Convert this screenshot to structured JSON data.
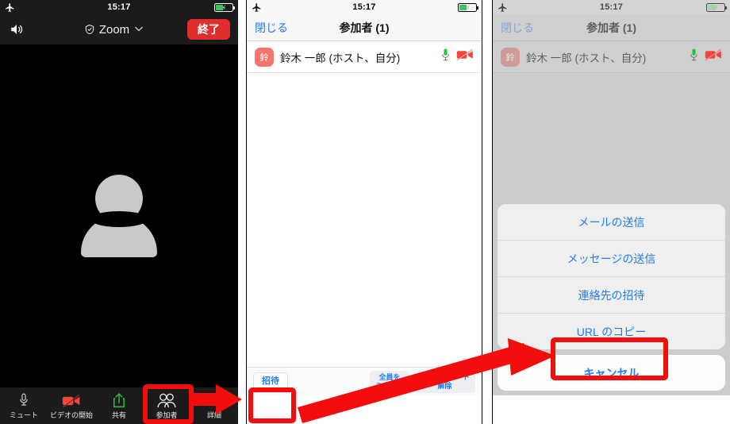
{
  "panels": {
    "meeting": {
      "status_bar": {
        "icon": "airplane-mode-icon",
        "time": "15:17",
        "battery": "battery-charging-icon"
      },
      "top_bar": {
        "speaker_icon": "speaker-icon",
        "shield_icon": "shield-check-icon",
        "app_name": "Zoom",
        "chevron": "⌄",
        "end_label": "終了"
      },
      "video": {
        "placeholder_icon": "person-silhouette-icon"
      },
      "toolbar": [
        {
          "icon": "microphone-icon",
          "label": "ミュート"
        },
        {
          "icon": "video-off-icon",
          "label": "ビデオの開始"
        },
        {
          "icon": "share-icon",
          "label": "共有"
        },
        {
          "icon": "participants-icon",
          "label": "参加者"
        },
        {
          "icon": "more-icon",
          "label": "詳細"
        }
      ]
    },
    "participants": {
      "status_bar": {
        "icon": "airplane-mode-icon",
        "time": "15:17",
        "battery": "battery-charging-icon"
      },
      "nav": {
        "close_label": "閉じる",
        "title": "参加者 (1)"
      },
      "rows": [
        {
          "avatar_initial": "鈴",
          "name": "鈴木 一郎 (ホスト、自分)",
          "mic_icon": "microphone-on-icon",
          "video_icon": "video-off-icon"
        }
      ],
      "footer": {
        "invite_label": "招待",
        "mute_all_label": "全員を\nミュート",
        "unmute_all_label": "全員をミュート\n解除"
      }
    },
    "invite": {
      "status_bar": {
        "icon": "airplane-mode-icon",
        "time": "15:17",
        "battery": "battery-charging-icon"
      },
      "nav": {
        "close_label": "閉じる",
        "title": "参加者 (1)"
      },
      "rows": [
        {
          "avatar_initial": "鈴",
          "name": "鈴木 一郎 (ホスト、自分)",
          "mic_icon": "microphone-on-icon",
          "video_icon": "video-off-icon"
        }
      ],
      "action_sheet": {
        "items": [
          "メールの送信",
          "メッセージの送信",
          "連絡先の招待",
          "URL のコピー"
        ],
        "cancel_label": "キャンセル"
      }
    }
  },
  "annotations": {
    "highlight_color": "#f40d0d",
    "boxes": [
      {
        "target": "participants-toolbar-button"
      },
      {
        "target": "invite-button"
      },
      {
        "target": "copy-url-sheet-item"
      }
    ],
    "arrows": [
      {
        "from": "participants-toolbar-button",
        "to": "invite-button"
      },
      {
        "from": "invite-button",
        "to": "copy-url-sheet-item"
      }
    ]
  }
}
